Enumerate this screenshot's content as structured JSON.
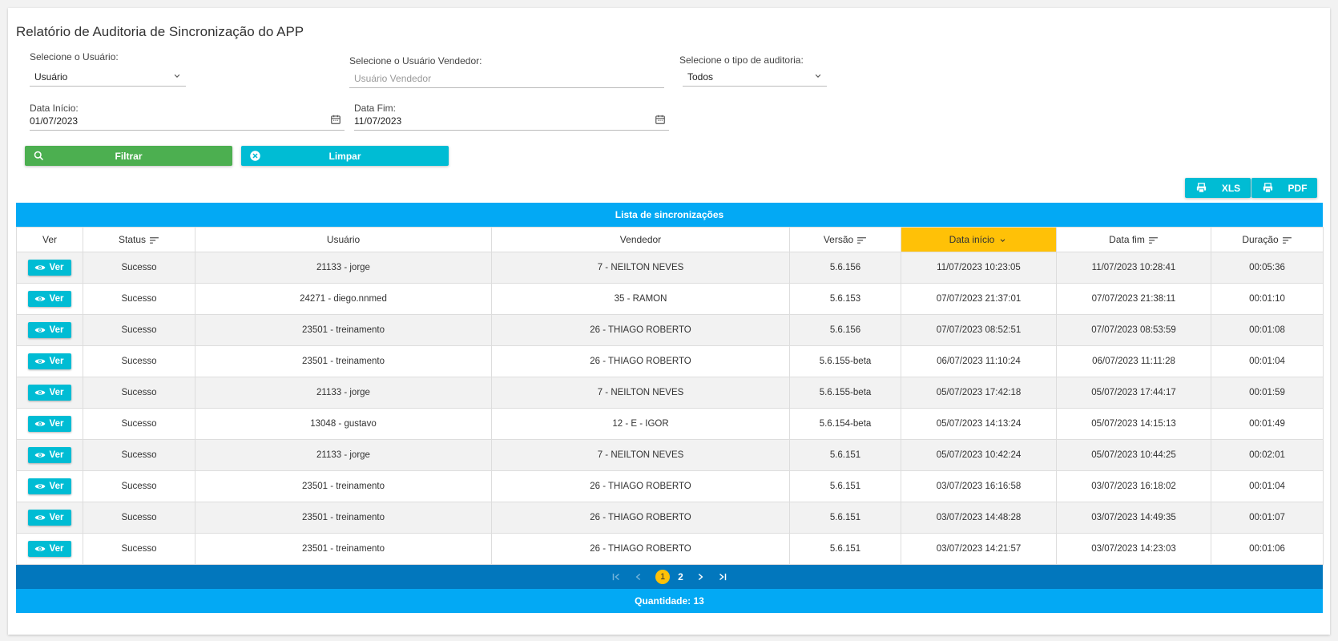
{
  "title": "Relatório de Auditoria de Sincronização do APP",
  "filters": {
    "usuario_label": "Selecione o Usuário:",
    "usuario_value": "Usuário",
    "vendedor_label": "Selecione o Usuário Vendedor:",
    "vendedor_placeholder": "Usuário Vendedor",
    "tipo_label": "Selecione o tipo de auditoria:",
    "tipo_value": "Todos",
    "data_inicio_label": "Data Início:",
    "data_inicio_value": "01/07/2023",
    "data_fim_label": "Data Fim:",
    "data_fim_value": "11/07/2023"
  },
  "buttons": {
    "filtrar": "Filtrar",
    "limpar": "Limpar",
    "xls": "XLS",
    "pdf": "PDF"
  },
  "table": {
    "title": "Lista de sincronizações",
    "headers": [
      "Ver",
      "Status",
      "Usuário",
      "Vendedor",
      "Versão",
      "Data início",
      "Data fim",
      "Duração"
    ],
    "active_sort_column": "Data início",
    "active_color": "#ffc107",
    "view_label": "Ver",
    "rows": [
      [
        "Sucesso",
        "21133 - jorge",
        "7 - NEILTON NEVES",
        "5.6.156",
        "11/07/2023 10:23:05",
        "11/07/2023 10:28:41",
        "00:05:36"
      ],
      [
        "Sucesso",
        "24271 - diego.nnmed",
        "35 - RAMON",
        "5.6.153",
        "07/07/2023 21:37:01",
        "07/07/2023 21:38:11",
        "00:01:10"
      ],
      [
        "Sucesso",
        "23501 - treinamento",
        "26 - THIAGO ROBERTO",
        "5.6.156",
        "07/07/2023 08:52:51",
        "07/07/2023 08:53:59",
        "00:01:08"
      ],
      [
        "Sucesso",
        "23501 - treinamento",
        "26 - THIAGO ROBERTO",
        "5.6.155-beta",
        "06/07/2023 11:10:24",
        "06/07/2023 11:11:28",
        "00:01:04"
      ],
      [
        "Sucesso",
        "21133 - jorge",
        "7 - NEILTON NEVES",
        "5.6.155-beta",
        "05/07/2023 17:42:18",
        "05/07/2023 17:44:17",
        "00:01:59"
      ],
      [
        "Sucesso",
        "13048 - gustavo",
        "12 - E - IGOR",
        "5.6.154-beta",
        "05/07/2023 14:13:24",
        "05/07/2023 14:15:13",
        "00:01:49"
      ],
      [
        "Sucesso",
        "21133 - jorge",
        "7 - NEILTON NEVES",
        "5.6.151",
        "05/07/2023 10:42:24",
        "05/07/2023 10:44:25",
        "00:02:01"
      ],
      [
        "Sucesso",
        "23501 - treinamento",
        "26 - THIAGO ROBERTO",
        "5.6.151",
        "03/07/2023 16:16:58",
        "03/07/2023 16:18:02",
        "00:01:04"
      ],
      [
        "Sucesso",
        "23501 - treinamento",
        "26 - THIAGO ROBERTO",
        "5.6.151",
        "03/07/2023 14:48:28",
        "03/07/2023 14:49:35",
        "00:01:07"
      ],
      [
        "Sucesso",
        "23501 - treinamento",
        "26 - THIAGO ROBERTO",
        "5.6.151",
        "03/07/2023 14:21:57",
        "03/07/2023 14:23:03",
        "00:01:06"
      ]
    ]
  },
  "pagination": {
    "current_page": "1",
    "next_page": "2",
    "icons": [
      "first-page-icon",
      "prev-page-icon",
      "next-page-icon",
      "last-page-icon"
    ]
  },
  "quantity": "Quantidade: 13"
}
